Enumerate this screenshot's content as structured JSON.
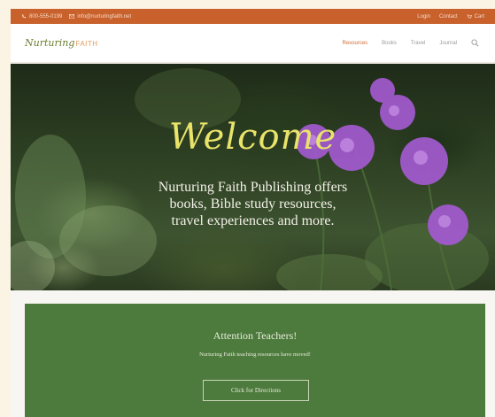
{
  "topbar": {
    "phone": "800-555-0199",
    "email": "info@nurturingfaith.net",
    "links": [
      "Login",
      "Contact",
      "Cart"
    ]
  },
  "logo": {
    "part1": "Nurturing",
    "part2": "FAITH"
  },
  "nav": {
    "items": [
      "Resources",
      "Books",
      "Travel",
      "Journal"
    ],
    "active_index": 0
  },
  "hero": {
    "title": "Welcome",
    "subtitle_lines": [
      "Nurturing Faith Publishing offers",
      "books, Bible study resources,",
      "travel experiences and more."
    ]
  },
  "promo": {
    "title": "Attention Teachers!",
    "text": "Nurturing Faith teaching resources have moved!",
    "button": "Click for Directions"
  },
  "colors": {
    "topbar": "#c8612b",
    "promo": "#4d7a3d",
    "welcome": "#e9e36a",
    "flower": "#a35ad0"
  }
}
